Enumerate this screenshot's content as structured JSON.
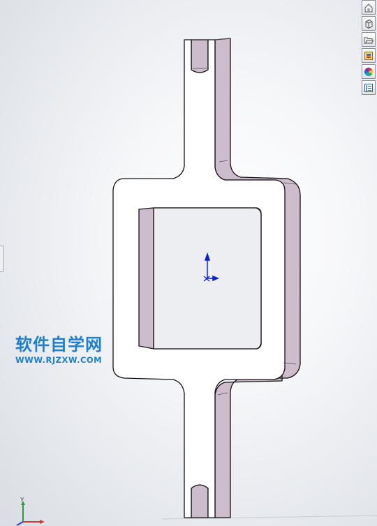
{
  "watermark": {
    "site_name": "软件自学网",
    "url": "WWW.RJZXW.COM"
  },
  "triad": {
    "y_label": "Y"
  },
  "right_toolbar": {
    "items": [
      {
        "icon": "home-view-icon"
      },
      {
        "icon": "view-orientation-cube-icon"
      },
      {
        "icon": "folder-open-icon"
      },
      {
        "icon": "appearance-scene-icon"
      },
      {
        "icon": "color-wheel-icon"
      },
      {
        "icon": "custom-properties-icon"
      }
    ]
  },
  "colors": {
    "part_face": "#ffffff",
    "part_side": "#cdbccb",
    "edge": "#111111",
    "origin": "#0b1fd6",
    "watermark": "#1d7fd2"
  }
}
